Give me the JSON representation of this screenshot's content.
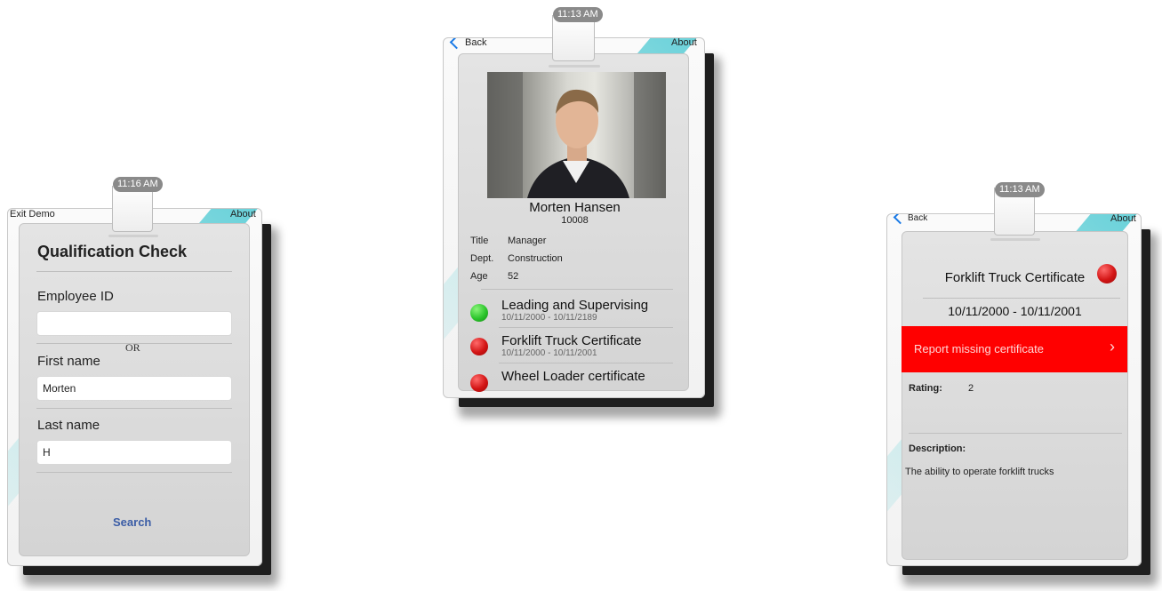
{
  "colors": {
    "accent_blue": "#1a7ae6",
    "report_red": "#ff0000",
    "stripe_teal": "#48c8d2"
  },
  "screen1": {
    "status_time": "11:16 AM",
    "nav_left": "Exit Demo",
    "nav_right": "About",
    "title": "Qualification Check",
    "employee_id_label": "Employee ID",
    "employee_id_value": "",
    "or_text": "OR",
    "first_name_label": "First name",
    "first_name_value": "Morten",
    "last_name_label": "Last name",
    "last_name_value": "H",
    "search_label": "Search"
  },
  "screen2": {
    "status_time": "11:13 AM",
    "nav_back": "Back",
    "nav_right": "About",
    "employee_name": "Morten Hansen",
    "employee_number": "10008",
    "info": [
      {
        "key": "Title",
        "value": "Manager"
      },
      {
        "key": "Dept.",
        "value": "Construction"
      },
      {
        "key": "Age",
        "value": "52"
      }
    ],
    "certificates": [
      {
        "name": "Leading and Supervising",
        "dates": "10/11/2000 - 10/11/2189",
        "status": "green"
      },
      {
        "name": "Forklift Truck Certificate",
        "dates": "10/11/2000 - 10/11/2001",
        "status": "red"
      },
      {
        "name": "Wheel Loader certificate",
        "dates": "",
        "status": "red"
      }
    ]
  },
  "screen3": {
    "status_time": "11:13 AM",
    "nav_back": "Back",
    "nav_right": "About",
    "cert_title": "Forklift Truck Certificate",
    "cert_dates": "10/11/2000 - 10/11/2001",
    "report_label": "Report missing certificate",
    "report_chevron": "›",
    "rating_label": "Rating:",
    "rating_value": "2",
    "description_label": "Description:",
    "description_text": "The ability to operate forklift trucks"
  }
}
